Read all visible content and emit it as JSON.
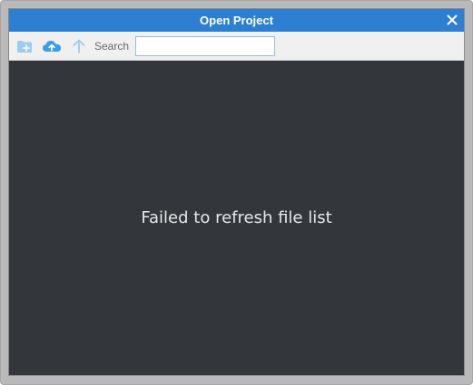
{
  "window": {
    "title": "Open Project"
  },
  "toolbar": {
    "new_folder_icon": "folder-plus-icon",
    "upload_icon": "cloud-upload-icon",
    "up_icon": "arrow-up-icon",
    "search_label": "Search",
    "search_value": "",
    "search_placeholder": ""
  },
  "content": {
    "message": "Failed to refresh file list"
  },
  "colors": {
    "titlebar": "#2d7fd2",
    "content_bg": "#33373b",
    "toolbar_bg": "#f0f0f0",
    "icon_blue": "#5aaee8",
    "icon_blue_light": "#9ccdf0"
  }
}
